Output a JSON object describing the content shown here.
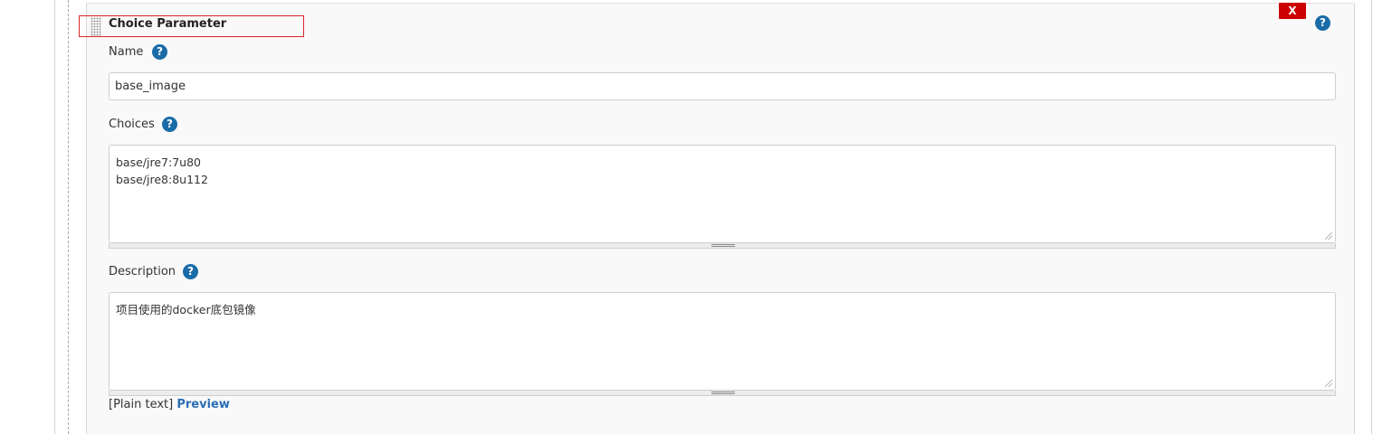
{
  "panel": {
    "title": "Choice Parameter",
    "delete_label": "X",
    "help_glyph": "?"
  },
  "fields": {
    "name": {
      "label": "Name",
      "value": "base_image"
    },
    "choices": {
      "label": "Choices",
      "value": "base/jre7:7u80\nbase/jre8:8u112"
    },
    "description": {
      "label": "Description",
      "value": "项目使用的docker底包镜像"
    }
  },
  "markup": {
    "plain_text": "[Plain text]",
    "preview_label": "Preview"
  },
  "icons": {
    "help": "help-icon",
    "delete": "close-icon",
    "drag": "drag-handle-icon"
  },
  "colors": {
    "delete_red": "#cc0000",
    "help_blue": "#1a6ca8",
    "link_blue": "#2a6eb6",
    "highlight_red": "#d9262c"
  }
}
